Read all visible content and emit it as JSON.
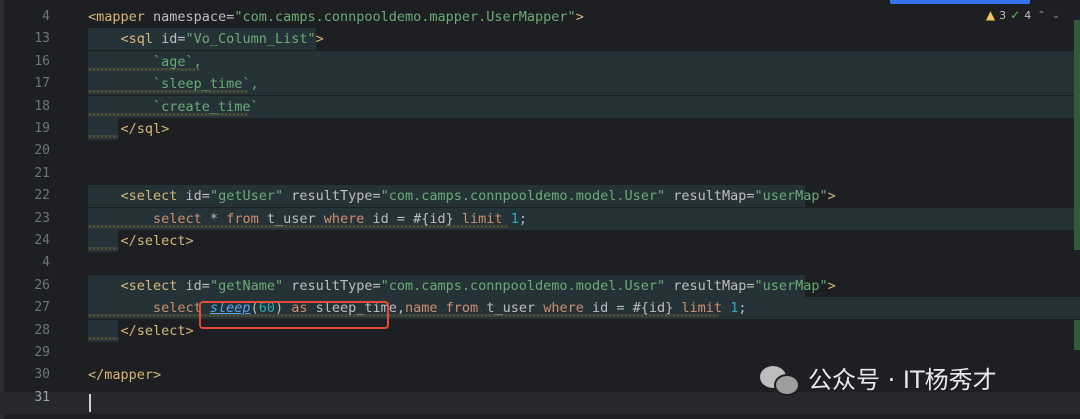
{
  "inspections": {
    "warnings": "3",
    "checks": "4"
  },
  "lines": [
    {
      "num": "4",
      "tokens": [
        [
          "tag",
          "<mapper "
        ],
        [
          "attr",
          "namespace="
        ],
        [
          "str",
          "\"com.camps.connpooldemo.mapper.UserMapper\""
        ],
        [
          "tag",
          ">"
        ]
      ]
    },
    {
      "num": "13",
      "tokens": [
        [
          "tag",
          "    <sql "
        ],
        [
          "attr",
          "id="
        ],
        [
          "str",
          "\"Vo_Column_List\""
        ],
        [
          "tag",
          ">"
        ]
      ]
    },
    {
      "num": "16",
      "tokens": [
        [
          "str",
          "        `age`,"
        ]
      ]
    },
    {
      "num": "17",
      "tokens": [
        [
          "str",
          "        `sleep_time`,"
        ]
      ]
    },
    {
      "num": "18",
      "tokens": [
        [
          "str",
          "        `create_time`"
        ]
      ]
    },
    {
      "num": "19",
      "tokens": [
        [
          "tag",
          "    </sql>"
        ]
      ]
    },
    {
      "num": "20",
      "tokens": []
    },
    {
      "num": "21",
      "tokens": []
    },
    {
      "num": "22",
      "tokens": [
        [
          "tag",
          "    <select "
        ],
        [
          "attr",
          "id="
        ],
        [
          "str",
          "\"getUser\" "
        ],
        [
          "attr",
          "resultType="
        ],
        [
          "str",
          "\"com.camps.connpooldemo.model.User\" "
        ],
        [
          "attr",
          "resultMap="
        ],
        [
          "str",
          "\"userMap\""
        ],
        [
          "tag",
          ">"
        ]
      ]
    },
    {
      "num": "23",
      "tokens": [
        [
          "kw",
          "        select "
        ],
        [
          "ident",
          "* "
        ],
        [
          "kw",
          "from "
        ],
        [
          "ident",
          "t_user "
        ],
        [
          "kw",
          "where "
        ],
        [
          "ident",
          "id = #{id} "
        ],
        [
          "kw",
          "limit "
        ],
        [
          "num",
          "1"
        ],
        [
          "ident",
          ";"
        ]
      ]
    },
    {
      "num": "24",
      "tokens": [
        [
          "tag",
          "    </select>"
        ]
      ]
    },
    {
      "num": "4",
      "tokens": []
    },
    {
      "num": "26",
      "tokens": [
        [
          "tag",
          "    <select "
        ],
        [
          "attr",
          "id="
        ],
        [
          "str",
          "\"getName\" "
        ],
        [
          "attr",
          "resultType="
        ],
        [
          "str",
          "\"com.camps.connpooldemo.model.User\" "
        ],
        [
          "attr",
          "resultMap="
        ],
        [
          "str",
          "\"userMap\""
        ],
        [
          "tag",
          ">"
        ]
      ]
    },
    {
      "num": "27",
      "tokens": [
        [
          "kw",
          "        select "
        ],
        [
          "fn",
          "sleep"
        ],
        [
          "ident",
          "("
        ],
        [
          "num",
          "60"
        ],
        [
          "ident",
          ") "
        ],
        [
          "kw",
          "as "
        ],
        [
          "ident",
          "sleep_time,"
        ],
        [
          "kw",
          "name "
        ],
        [
          "kw",
          "from "
        ],
        [
          "ident",
          "t_user "
        ],
        [
          "kw",
          "where "
        ],
        [
          "ident",
          "id = #{id} "
        ],
        [
          "kw",
          "limit "
        ],
        [
          "num",
          "1"
        ],
        [
          "ident",
          ";"
        ]
      ]
    },
    {
      "num": "28",
      "tokens": [
        [
          "tag",
          "    </select>"
        ]
      ]
    },
    {
      "num": "29",
      "tokens": []
    },
    {
      "num": "30",
      "tokens": [
        [
          "tag",
          "</mapper>"
        ]
      ]
    },
    {
      "num": "31",
      "tokens": []
    }
  ],
  "watermark": {
    "text": "公众号 · IT杨秀才"
  },
  "colors": {
    "background": "#1e1f22",
    "highlight": "#253338",
    "redbox": "#e5493a"
  }
}
